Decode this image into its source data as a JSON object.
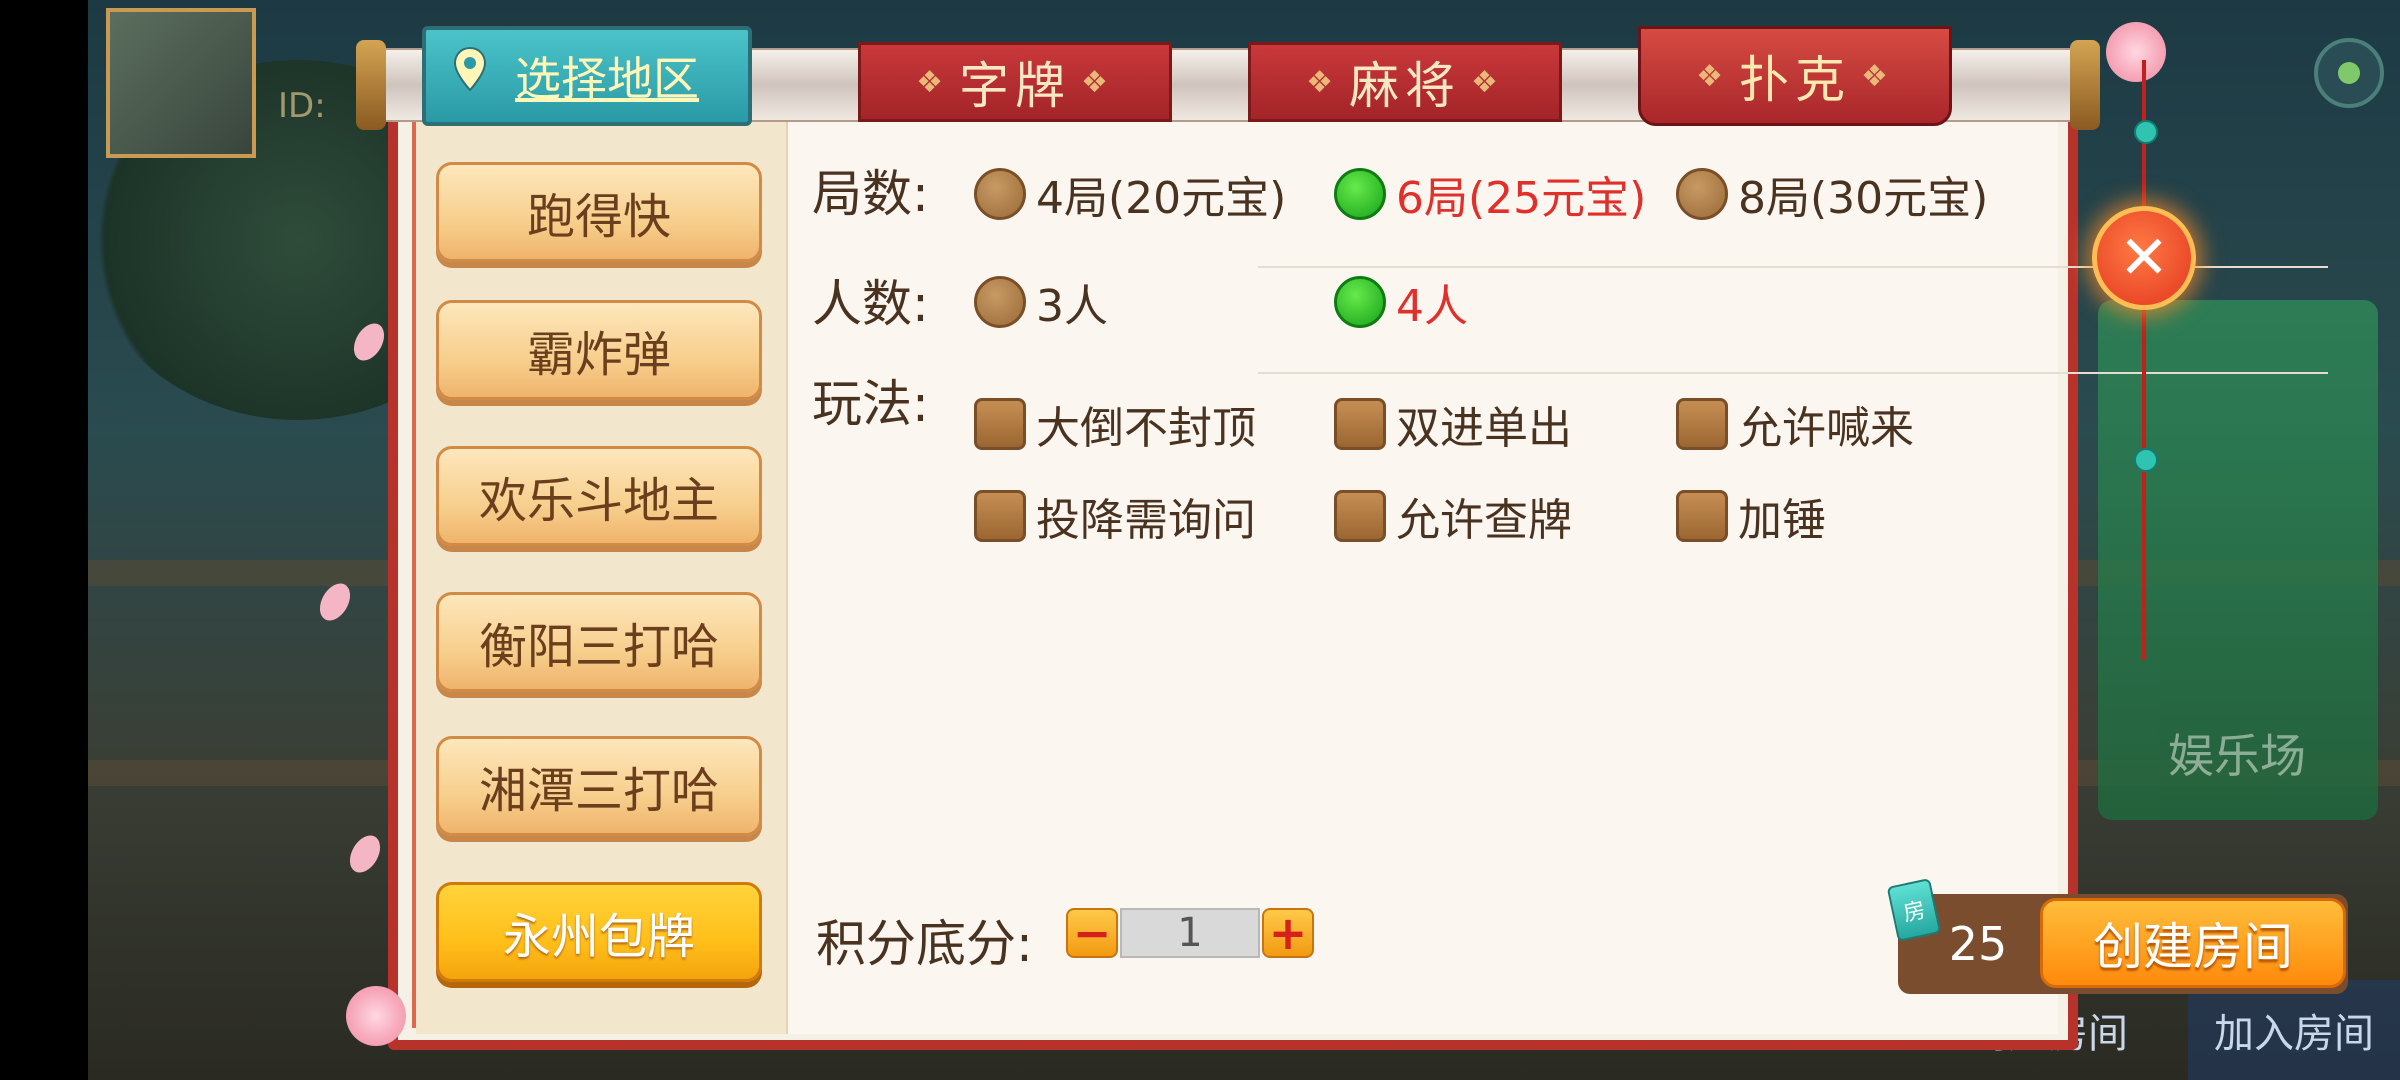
{
  "header": {
    "region_button_label": "选择地区",
    "tabs": [
      {
        "label": "字牌",
        "active": false
      },
      {
        "label": "麻将",
        "active": false
      },
      {
        "label": "扑克",
        "active": true
      }
    ]
  },
  "sidebar": {
    "items": [
      {
        "label": "跑得快",
        "active": false
      },
      {
        "label": "霸炸弹",
        "active": false
      },
      {
        "label": "欢乐斗地主",
        "active": false
      },
      {
        "label": "衡阳三打哈",
        "active": false
      },
      {
        "label": "湘潭三打哈",
        "active": false
      },
      {
        "label": "永州包牌",
        "active": true
      }
    ]
  },
  "rounds": {
    "label": "局数:",
    "options": [
      {
        "label": "4局(20元宝)",
        "selected": false
      },
      {
        "label": "6局(25元宝)",
        "selected": true
      },
      {
        "label": "8局(30元宝)",
        "selected": false
      }
    ]
  },
  "players": {
    "label": "人数:",
    "options": [
      {
        "label": "3人",
        "selected": false
      },
      {
        "label": "4人",
        "selected": true
      }
    ]
  },
  "rules": {
    "label": "玩法:",
    "options": [
      {
        "label": "大倒不封顶",
        "checked": false
      },
      {
        "label": "双进单出",
        "checked": false
      },
      {
        "label": "允许喊来",
        "checked": false
      },
      {
        "label": "投降需询问",
        "checked": false
      },
      {
        "label": "允许查牌",
        "checked": false
      },
      {
        "label": "加锤",
        "checked": false
      }
    ]
  },
  "score": {
    "label": "积分底分:",
    "value": "1",
    "minus": "−",
    "plus": "+"
  },
  "create": {
    "room_icon_text": "房",
    "cost": "25",
    "button_label": "创建房间"
  },
  "close": {
    "symbol": "✕"
  },
  "background": {
    "user_id_prefix": "ID:",
    "entertainment_label": "娱乐场",
    "create_room_bottom": "创建房间",
    "join_room_bottom": "加入房间"
  },
  "colors": {
    "frame": "#b8322c",
    "selected_text": "#e0302b",
    "radio_on": "#16a21a",
    "create_button": "#ff8a0c",
    "active_menu": "#ffbf1a"
  }
}
